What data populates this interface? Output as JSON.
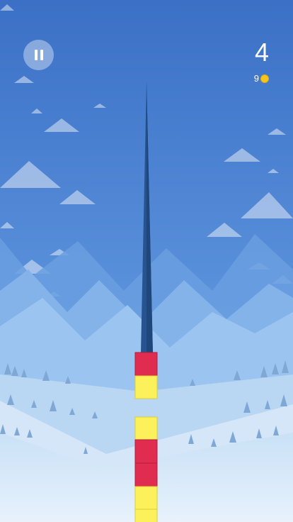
{
  "hud": {
    "score": "4",
    "coins": "9"
  },
  "colors": {
    "sky_top": "#3b70c6",
    "sky_bottom": "#76aee8",
    "accent_red": "#df2c4f",
    "accent_yellow": "#fcf15a",
    "spike": "#27548f",
    "coin": "#f7c51e"
  },
  "icons": {
    "pause": "pause-icon",
    "coin": "coin-icon"
  },
  "tower": {
    "upper_blocks": [
      "red",
      "yellow"
    ],
    "lower_blocks": [
      "yellow",
      "red",
      "red",
      "yellow",
      "yellow"
    ]
  }
}
